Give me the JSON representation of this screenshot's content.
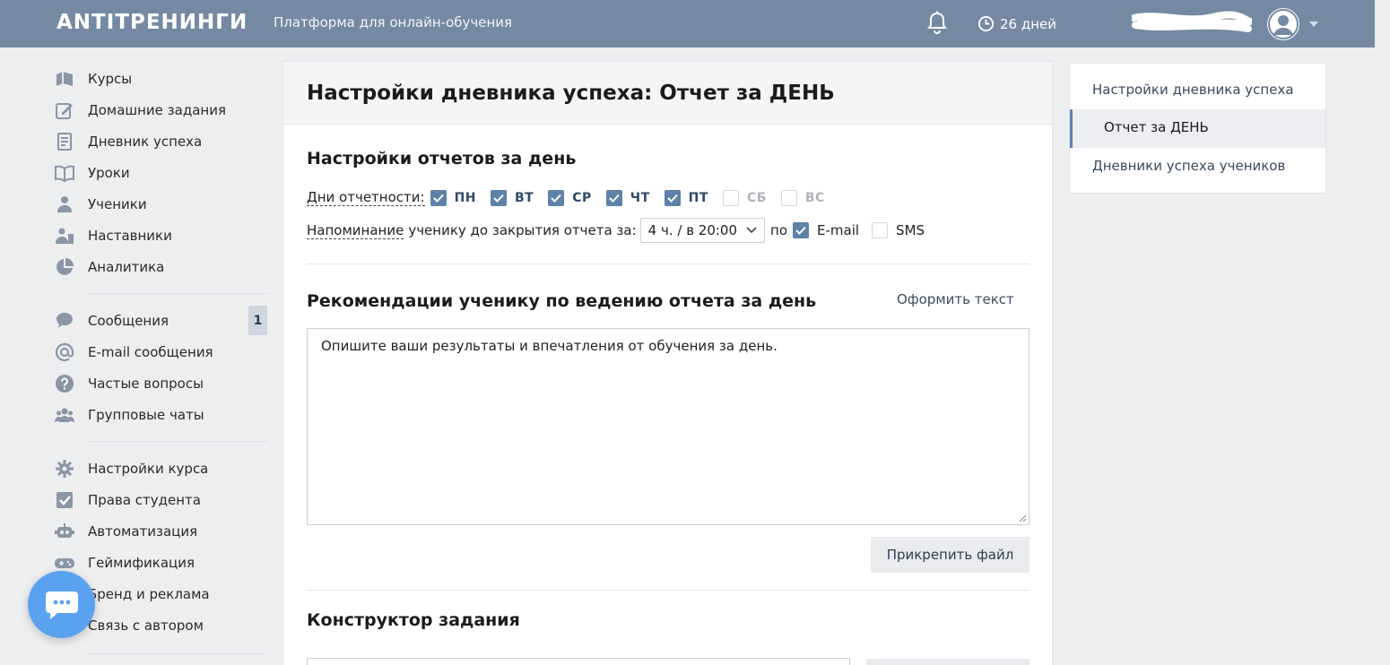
{
  "header": {
    "logo": "ANTITРЕНИНГИ",
    "tagline": "Платформа для онлайн-обучения",
    "timer": "26 дней"
  },
  "sidebar": {
    "group1": [
      {
        "label": "Курсы",
        "icon": "courses-icon"
      },
      {
        "label": "Домашние задания",
        "icon": "homework-icon"
      },
      {
        "label": "Дневник успеха",
        "icon": "diary-icon"
      },
      {
        "label": "Уроки",
        "icon": "lessons-icon"
      },
      {
        "label": "Ученики",
        "icon": "students-icon"
      },
      {
        "label": "Наставники",
        "icon": "mentors-icon"
      },
      {
        "label": "Аналитика",
        "icon": "analytics-icon"
      }
    ],
    "group2": [
      {
        "label": "Сообщения",
        "icon": "messages-icon",
        "badge": "1"
      },
      {
        "label": "E-mail сообщения",
        "icon": "at-icon"
      },
      {
        "label": "Частые вопросы",
        "icon": "question-icon"
      },
      {
        "label": "Групповые чаты",
        "icon": "group-chat-icon"
      }
    ],
    "group3": [
      {
        "label": "Настройки курса",
        "icon": "gear-icon"
      },
      {
        "label": "Права студента",
        "icon": "checkbox-icon"
      },
      {
        "label": "Автоматизация",
        "icon": "robot-icon"
      },
      {
        "label": "Геймификация",
        "icon": "gamepad-icon"
      },
      {
        "label": "Бренд и реклама",
        "icon": "brand-icon"
      },
      {
        "label": "Связь с автором",
        "icon": "contact-icon"
      }
    ]
  },
  "main": {
    "title": "Настройки дневника успеха: Отчет за ДЕНЬ",
    "section1_title": "Настройки отчетов за день",
    "days_label": "Дни отчетности:",
    "days": [
      {
        "label": "ПН",
        "checked": true
      },
      {
        "label": "ВТ",
        "checked": true
      },
      {
        "label": "СР",
        "checked": true
      },
      {
        "label": "ЧТ",
        "checked": true
      },
      {
        "label": "ПТ",
        "checked": true
      },
      {
        "label": "СБ",
        "checked": false
      },
      {
        "label": "ВС",
        "checked": false
      }
    ],
    "reminder_label_dotted": "Напоминание",
    "reminder_label_rest": "ученику до закрытия отчета за:",
    "reminder_select": "4 ч. / в 20:00",
    "by_label": "по",
    "email_label": "E-mail",
    "email_checked": true,
    "sms_label": "SMS",
    "sms_checked": false,
    "section2_title": "Рекомендации ученику по ведению отчета за день",
    "format_text_link": "Оформить текст",
    "recommendation_text": "Опишите ваши результаты и впечатления от обучения за день.",
    "attach_button": "Прикрепить файл",
    "section3_title": "Конструктор задания"
  },
  "right_panel": {
    "item1": "Настройки дневника успеха",
    "item2_active": "Отчет за ДЕНЬ",
    "item3": "Дневники успеха учеников"
  },
  "colors": {
    "topbar": "#7589a3",
    "accent": "#5e81a8",
    "chat_fab": "#5aa2f0"
  }
}
